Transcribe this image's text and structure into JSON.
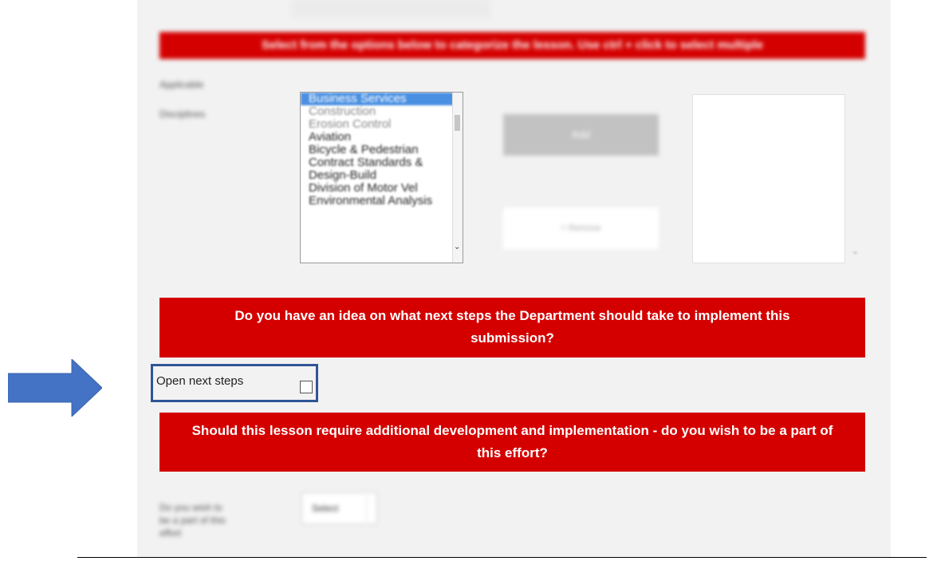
{
  "form": {
    "top_banner": "Select from the options below to categorize the lesson. Use ctrl + click to select multiple",
    "label_applicable": "Applicable",
    "label_disciplines": "Disciplines",
    "listbox_options": [
      "Business Services",
      "Construction",
      "Erosion Control",
      "Aviation",
      "Bicycle & Pedestrian",
      "Contract Standards &",
      "Design-Build",
      "Division of Motor Vel",
      "Environmental Analysis"
    ],
    "add_button": "Add",
    "remove_button": "< Remove",
    "next_steps_banner": "Do you have an idea on what next steps the Department should take to implement this submission?",
    "next_steps_label": "Open next steps",
    "participation_banner": "Should this lesson require additional development and implementation - do you wish to be a part of this effort?",
    "participation_label": "Do you wish to be a part of this effort",
    "participation_select": "Select"
  },
  "colors": {
    "banner_red": "#d40000",
    "highlight_blue": "#2f5597",
    "arrow_blue": "#4472c4"
  },
  "icons": {
    "pointer_arrow": "right-arrow-icon"
  }
}
